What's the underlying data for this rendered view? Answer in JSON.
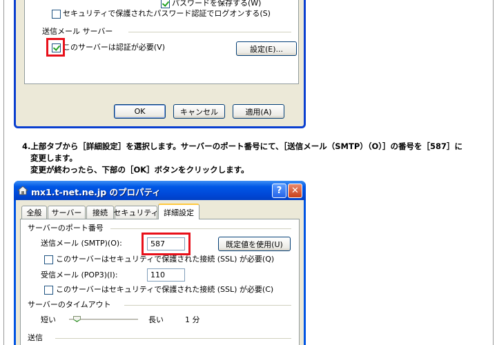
{
  "dialog1": {
    "remember_password": "パスワードを保存する(W)",
    "spa_logon": "セキュリティで保護されたパスワード認証でログオンする(S)",
    "outgoing_group": "送信メール サーバー",
    "auth_required": "このサーバーは認証が必要(V)",
    "settings_button": "設定(E)...",
    "ok_button": "OK",
    "cancel_button": "キャンセル",
    "apply_button": "適用(A)"
  },
  "instruction": {
    "line1": "4.上部タブから［詳細設定］を選択します。サーバーのポート番号にて、［送信メール（SMTP）（O）］の番号を［587］に",
    "line2": "変更します。",
    "line3": "変更が終わったら、下部の［OK］ボタンをクリックします。"
  },
  "dialog2": {
    "title": "mx1.t-net.ne.jp のプロパティ",
    "help_glyph": "?",
    "close_glyph": "✕",
    "tabs": [
      {
        "label": "全般"
      },
      {
        "label": "サーバー"
      },
      {
        "label": "接続"
      },
      {
        "label": "セキュリティ"
      },
      {
        "label": "詳細設定"
      }
    ],
    "ports_group": "サーバーのポート番号",
    "smtp_label": "送信メール (SMTP)(O):",
    "smtp_value": "587",
    "default_button": "既定値を使用(U)",
    "smtp_ssl": "このサーバーはセキュリティで保護された接続 (SSL) が必要(Q)",
    "pop3_label": "受信メール (POP3)(I):",
    "pop3_value": "110",
    "pop3_ssl": "このサーバーはセキュリティで保護された接続 (SSL) が必要(C)",
    "timeout_group": "サーバーのタイムアウト",
    "timeout_short": "短い",
    "timeout_long": "長い",
    "timeout_value": "1 分",
    "send_group": "送信"
  },
  "colors": {
    "highlight": "#e8101a",
    "title_blue": "#0054e3"
  }
}
